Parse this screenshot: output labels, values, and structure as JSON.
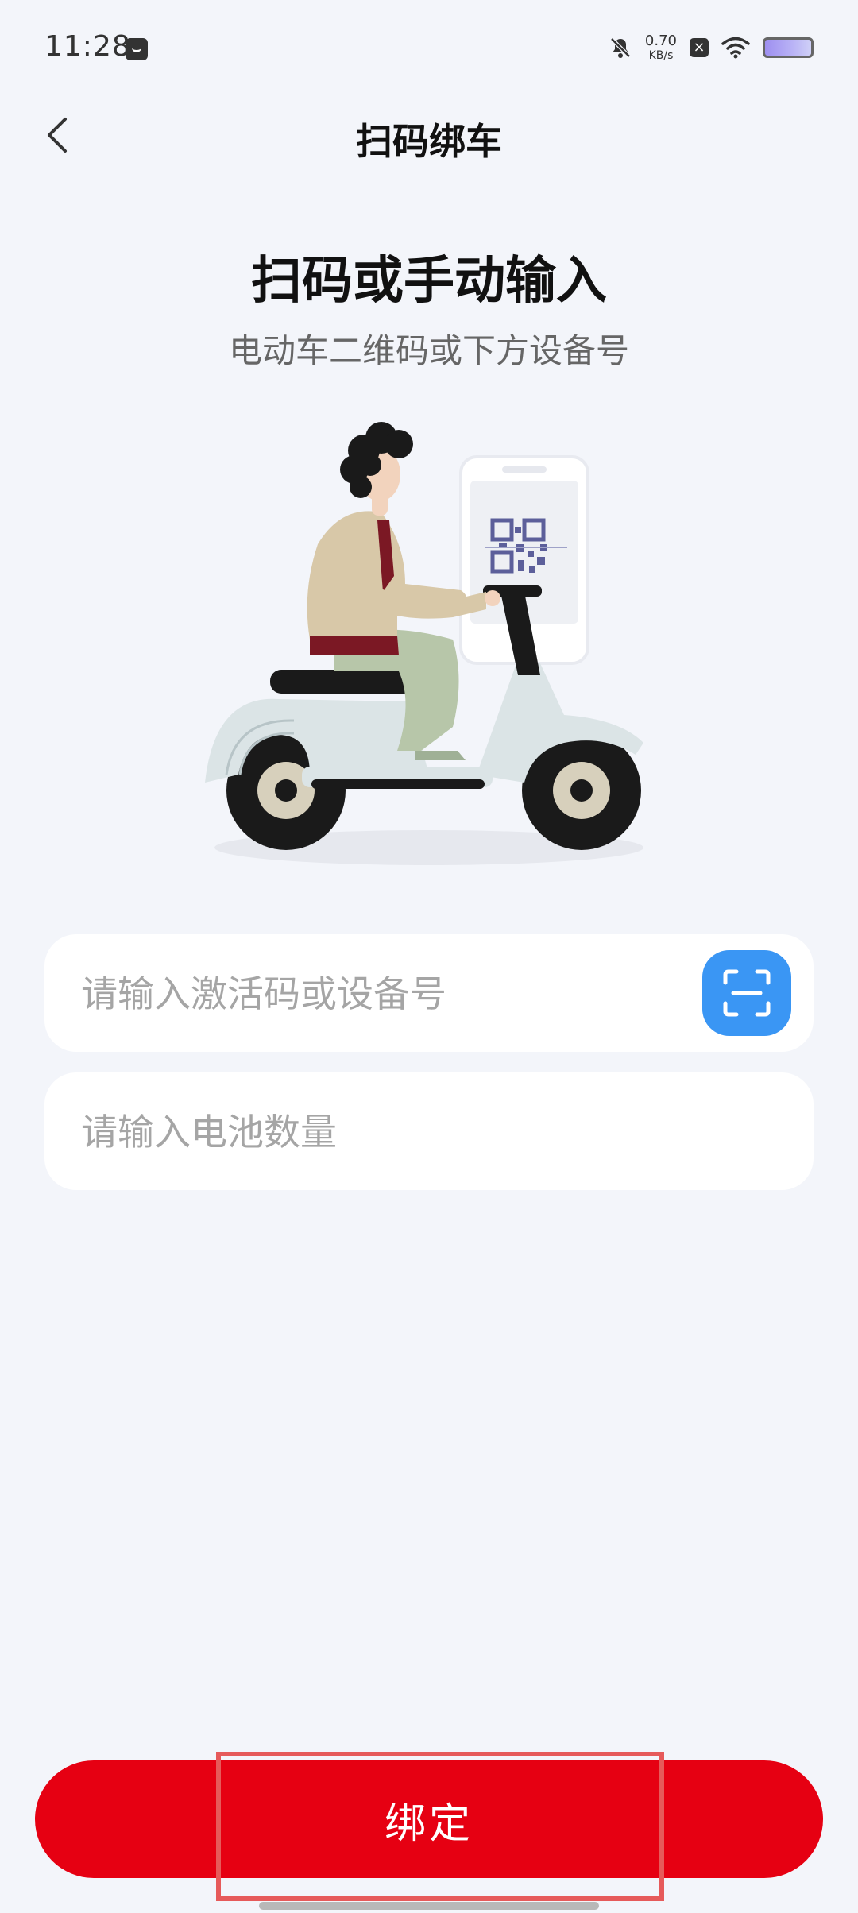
{
  "status_bar": {
    "time": "11:28",
    "net_speed_value": "0.70",
    "net_speed_unit": "KB/s",
    "icons": [
      "app-notification-icon",
      "mute-icon",
      "close-badge-icon",
      "wifi-icon",
      "battery-icon"
    ]
  },
  "header": {
    "back_icon": "chevron-left-icon",
    "title": "扫码绑车"
  },
  "intro": {
    "heading": "扫码或手动输入",
    "subheading": "电动车二维码或下方设备号"
  },
  "form": {
    "device_code_placeholder": "请输入激活码或设备号",
    "device_code_value": "",
    "scan_icon": "scan-icon",
    "battery_count_placeholder": "请输入电池数量",
    "battery_count_value": ""
  },
  "actions": {
    "bind_label": "绑定"
  },
  "colors": {
    "background": "#f3f5fa",
    "primary_red": "#e60012",
    "scan_blue": "#3a96f4",
    "highlight": "#e65a5a"
  }
}
